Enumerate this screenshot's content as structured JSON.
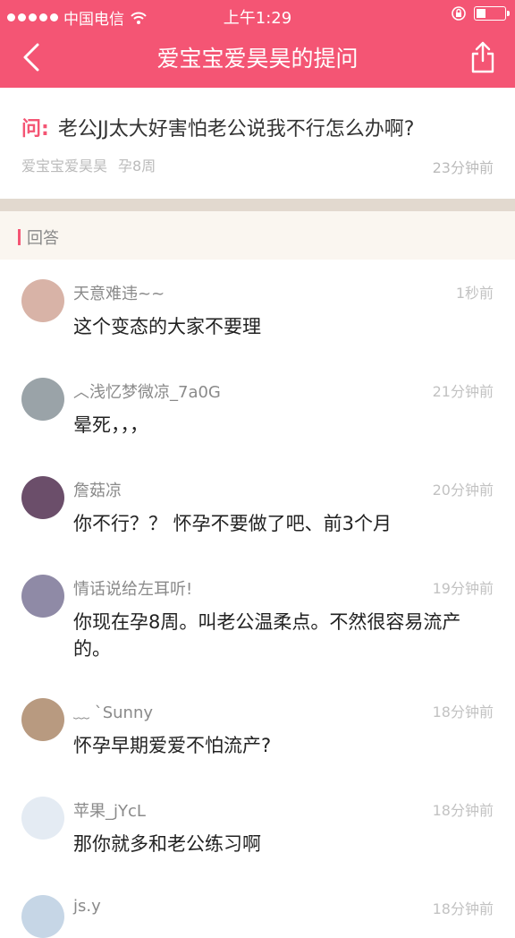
{
  "status_bar": {
    "carrier": "中国电信",
    "time": "上午1:29"
  },
  "nav": {
    "title": "爱宝宝爱昊昊的提问"
  },
  "question": {
    "label": "问:",
    "text": "老公JJ太大好害怕老公说我不行怎么办啊?",
    "author": "爱宝宝爱昊昊",
    "stage": "孕8周",
    "time": "23分钟前"
  },
  "answers_header": "回答",
  "answers": [
    {
      "name": "天意难违~~",
      "time": "1秒前",
      "text": "这个变态的大家不要理",
      "avatar_color": "#d8b3a7"
    },
    {
      "name": "︿浅忆梦微凉_7a0G",
      "time": "21分钟前",
      "text": "晕死，，，",
      "avatar_color": "#9aa3a8"
    },
    {
      "name": "詹菇凉",
      "time": "20分钟前",
      "text": "你不行？？ 怀孕不要做了吧、前3个月",
      "avatar_color": "#6b4e6a"
    },
    {
      "name": "情话说给左耳听!",
      "time": "19分钟前",
      "text": "你现在孕8周。叫老公温柔点。不然很容易流产的。",
      "avatar_color": "#8f8aa6"
    },
    {
      "name": "﹏ `Sunny",
      "time": "18分钟前",
      "text": "怀孕早期爱爱不怕流产?",
      "avatar_color": "#b89a80"
    },
    {
      "name": "苹果_jYcL",
      "time": "18分钟前",
      "text": "那你就多和老公练习啊",
      "avatar_color": "#e4ebf3"
    },
    {
      "name": "js.y",
      "time": "18分钟前",
      "text": "",
      "avatar_color": "#c6d6e6"
    }
  ]
}
